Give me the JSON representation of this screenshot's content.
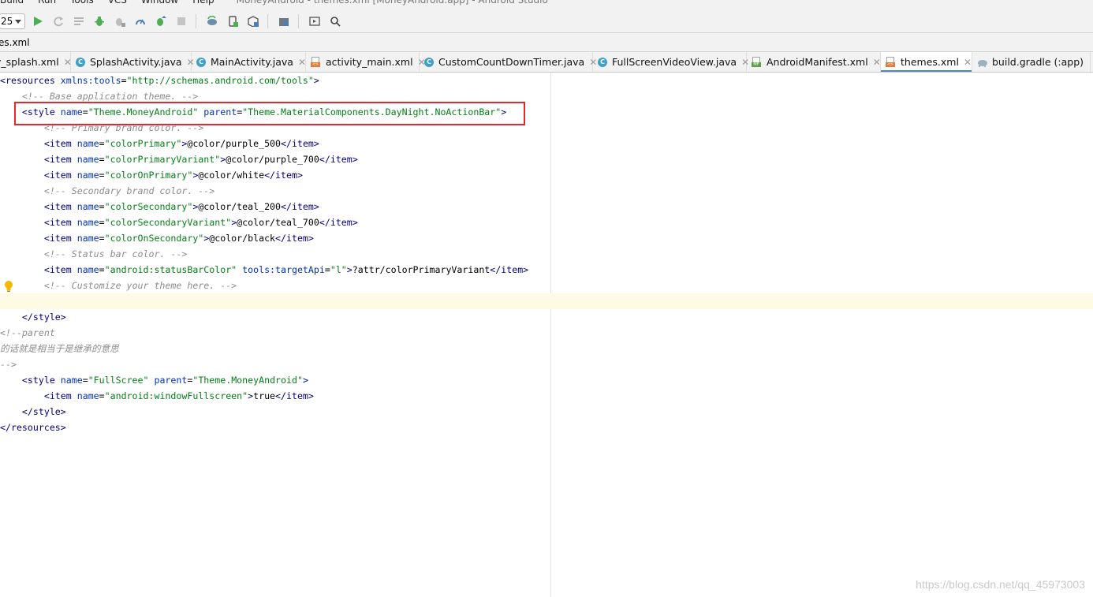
{
  "menu": {
    "items": [
      "Build",
      "Run",
      "Tools",
      "VCS",
      "Window",
      "Help"
    ],
    "window_title": "MoneyAndroid - themes.xml [MoneyAndroid.app] - Android Studio"
  },
  "toolbar": {
    "device_combo_value": "25"
  },
  "breadcrumb": {
    "file": "es.xml"
  },
  "tabs": [
    {
      "label": "y_splash.xml",
      "type": "xml",
      "active": false
    },
    {
      "label": "SplashActivity.java",
      "type": "class",
      "active": false
    },
    {
      "label": "MainActivity.java",
      "type": "class",
      "active": false
    },
    {
      "label": "activity_main.xml",
      "type": "xml",
      "active": false
    },
    {
      "label": "CustomCountDownTimer.java",
      "type": "class",
      "active": false
    },
    {
      "label": "FullScreenVideoView.java",
      "type": "class",
      "active": false
    },
    {
      "label": "AndroidManifest.xml",
      "type": "manifest",
      "active": false
    },
    {
      "label": "themes.xml",
      "type": "xml",
      "active": true
    },
    {
      "label": "build.gradle (:app)",
      "type": "gradle",
      "active": false
    }
  ],
  "code": [
    [
      {
        "c": "t-tag",
        "t": "<resources "
      },
      {
        "c": "t-attr",
        "t": "xmlns:tools"
      },
      {
        "c": "t-txt",
        "t": "="
      },
      {
        "c": "t-str",
        "t": "\"http://schemas.android.com/tools\""
      },
      {
        "c": "t-tag",
        "t": ">"
      }
    ],
    [
      {
        "c": "t-txt",
        "t": "    "
      },
      {
        "c": "t-com",
        "t": "<!-- Base application theme. -->"
      }
    ],
    [
      {
        "c": "t-txt",
        "t": "    "
      },
      {
        "c": "t-tag",
        "t": "<style "
      },
      {
        "c": "t-attr",
        "t": "name"
      },
      {
        "c": "t-txt",
        "t": "="
      },
      {
        "c": "t-str",
        "t": "\"Theme.MoneyAndroid\""
      },
      {
        "c": "t-txt",
        "t": " "
      },
      {
        "c": "t-attr",
        "t": "parent"
      },
      {
        "c": "t-txt",
        "t": "="
      },
      {
        "c": "t-str",
        "t": "\"Theme.MaterialComponents.DayNight.NoActionBar\""
      },
      {
        "c": "t-tag",
        "t": ">"
      }
    ],
    [
      {
        "c": "t-txt",
        "t": "        "
      },
      {
        "c": "t-com",
        "t": "<!-- Primary brand color. -->"
      }
    ],
    [
      {
        "c": "t-txt",
        "t": "        "
      },
      {
        "c": "t-tag",
        "t": "<item "
      },
      {
        "c": "t-attr",
        "t": "name"
      },
      {
        "c": "t-txt",
        "t": "="
      },
      {
        "c": "t-str",
        "t": "\"colorPrimary\""
      },
      {
        "c": "t-tag",
        "t": ">"
      },
      {
        "c": "t-txt",
        "t": "@color/purple_500"
      },
      {
        "c": "t-tag",
        "t": "</item>"
      }
    ],
    [
      {
        "c": "t-txt",
        "t": "        "
      },
      {
        "c": "t-tag",
        "t": "<item "
      },
      {
        "c": "t-attr",
        "t": "name"
      },
      {
        "c": "t-txt",
        "t": "="
      },
      {
        "c": "t-str",
        "t": "\"colorPrimaryVariant\""
      },
      {
        "c": "t-tag",
        "t": ">"
      },
      {
        "c": "t-txt",
        "t": "@color/purple_700"
      },
      {
        "c": "t-tag",
        "t": "</item>"
      }
    ],
    [
      {
        "c": "t-txt",
        "t": "        "
      },
      {
        "c": "t-tag",
        "t": "<item "
      },
      {
        "c": "t-attr",
        "t": "name"
      },
      {
        "c": "t-txt",
        "t": "="
      },
      {
        "c": "t-str",
        "t": "\"colorOnPrimary\""
      },
      {
        "c": "t-tag",
        "t": ">"
      },
      {
        "c": "t-txt",
        "t": "@color/white"
      },
      {
        "c": "t-tag",
        "t": "</item>"
      }
    ],
    [
      {
        "c": "t-txt",
        "t": "        "
      },
      {
        "c": "t-com",
        "t": "<!-- Secondary brand color. -->"
      }
    ],
    [
      {
        "c": "t-txt",
        "t": "        "
      },
      {
        "c": "t-tag",
        "t": "<item "
      },
      {
        "c": "t-attr",
        "t": "name"
      },
      {
        "c": "t-txt",
        "t": "="
      },
      {
        "c": "t-str",
        "t": "\"colorSecondary\""
      },
      {
        "c": "t-tag",
        "t": ">"
      },
      {
        "c": "t-txt",
        "t": "@color/teal_200"
      },
      {
        "c": "t-tag",
        "t": "</item>"
      }
    ],
    [
      {
        "c": "t-txt",
        "t": "        "
      },
      {
        "c": "t-tag",
        "t": "<item "
      },
      {
        "c": "t-attr",
        "t": "name"
      },
      {
        "c": "t-txt",
        "t": "="
      },
      {
        "c": "t-str",
        "t": "\"colorSecondaryVariant\""
      },
      {
        "c": "t-tag",
        "t": ">"
      },
      {
        "c": "t-txt",
        "t": "@color/teal_700"
      },
      {
        "c": "t-tag",
        "t": "</item>"
      }
    ],
    [
      {
        "c": "t-txt",
        "t": "        "
      },
      {
        "c": "t-tag",
        "t": "<item "
      },
      {
        "c": "t-attr",
        "t": "name"
      },
      {
        "c": "t-txt",
        "t": "="
      },
      {
        "c": "t-str",
        "t": "\"colorOnSecondary\""
      },
      {
        "c": "t-tag",
        "t": ">"
      },
      {
        "c": "t-txt",
        "t": "@color/black"
      },
      {
        "c": "t-tag",
        "t": "</item>"
      }
    ],
    [
      {
        "c": "t-txt",
        "t": "        "
      },
      {
        "c": "t-com",
        "t": "<!-- Status bar color. -->"
      }
    ],
    [
      {
        "c": "t-txt",
        "t": "        "
      },
      {
        "c": "t-tag",
        "t": "<item "
      },
      {
        "c": "t-attr",
        "t": "name"
      },
      {
        "c": "t-txt",
        "t": "="
      },
      {
        "c": "t-str",
        "t": "\"android:statusBarColor\""
      },
      {
        "c": "t-txt",
        "t": " "
      },
      {
        "c": "t-attr",
        "t": "tools:targetApi"
      },
      {
        "c": "t-txt",
        "t": "="
      },
      {
        "c": "t-str",
        "t": "\"l\""
      },
      {
        "c": "t-tag",
        "t": ">"
      },
      {
        "c": "t-txt",
        "t": "?attr/colorPrimaryVariant"
      },
      {
        "c": "t-tag",
        "t": "</item>"
      }
    ],
    [
      {
        "c": "t-txt",
        "t": "        "
      },
      {
        "c": "t-com",
        "t": "<!-- Customize your theme here. -->"
      }
    ],
    [
      {
        "c": "t-txt",
        "t": ""
      }
    ],
    [
      {
        "c": "t-txt",
        "t": "    "
      },
      {
        "c": "t-tag",
        "t": "</style>"
      }
    ],
    [
      {
        "c": "t-com",
        "t": "<!--parent"
      }
    ],
    [
      {
        "c": "t-com",
        "t": "的话就是相当于是继承的意思"
      }
    ],
    [
      {
        "c": "t-com",
        "t": "-->"
      }
    ],
    [
      {
        "c": "t-txt",
        "t": "    "
      },
      {
        "c": "t-tag",
        "t": "<style "
      },
      {
        "c": "t-attr",
        "t": "name"
      },
      {
        "c": "t-txt",
        "t": "="
      },
      {
        "c": "t-str",
        "t": "\"FullScree\""
      },
      {
        "c": "t-txt",
        "t": " "
      },
      {
        "c": "t-attr",
        "t": "parent"
      },
      {
        "c": "t-txt",
        "t": "="
      },
      {
        "c": "t-str",
        "t": "\"Theme.MoneyAndroid\""
      },
      {
        "c": "t-tag",
        "t": ">"
      }
    ],
    [
      {
        "c": "t-txt",
        "t": "        "
      },
      {
        "c": "t-tag",
        "t": "<item "
      },
      {
        "c": "t-attr",
        "t": "name"
      },
      {
        "c": "t-txt",
        "t": "="
      },
      {
        "c": "t-str",
        "t": "\"android:windowFullscreen\""
      },
      {
        "c": "t-tag",
        "t": ">"
      },
      {
        "c": "t-txt",
        "t": "true"
      },
      {
        "c": "t-tag",
        "t": "</item>"
      }
    ],
    [
      {
        "c": "t-txt",
        "t": "    "
      },
      {
        "c": "t-tag",
        "t": "</style>"
      }
    ],
    [
      {
        "c": "t-tag",
        "t": "</resources>"
      }
    ]
  ],
  "highlight_line": 14,
  "watermark": "https://blog.csdn.net/qq_45973003",
  "colors": {
    "annotation_red": "#e8262b",
    "active_tab_accent": "#4a88c7",
    "current_line": "#fffae3"
  }
}
